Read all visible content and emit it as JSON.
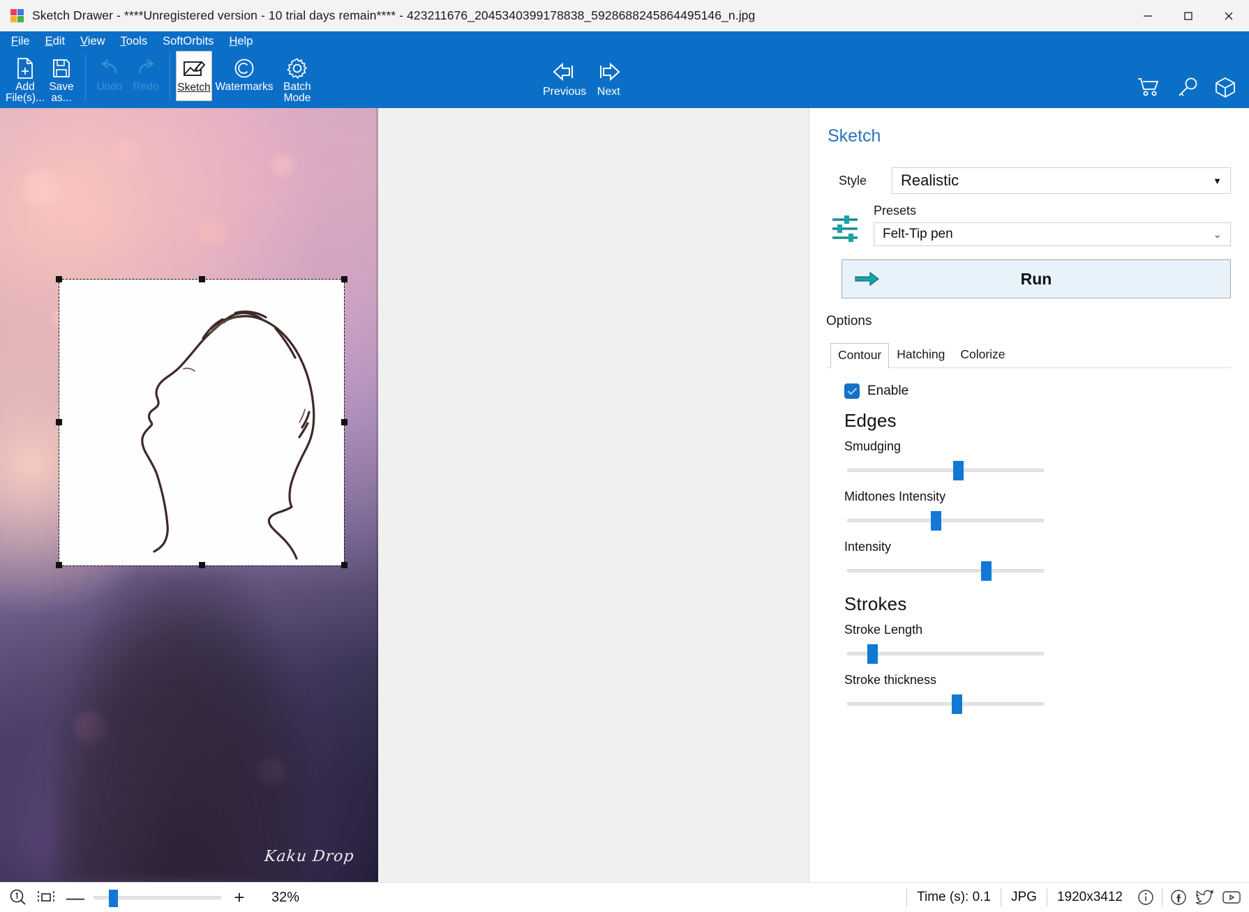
{
  "window": {
    "title": "Sketch Drawer - ****Unregistered version - 10 trial days remain**** - 423211676_2045340399178838_5928688245864495146_n.jpg",
    "minimize_label": "Minimize",
    "maximize_label": "Maximize",
    "close_label": "Close"
  },
  "menu": {
    "items": [
      {
        "label": "File",
        "accel": "F"
      },
      {
        "label": "Edit",
        "accel": "E"
      },
      {
        "label": "View",
        "accel": "V"
      },
      {
        "label": "Tools",
        "accel": "T"
      },
      {
        "label": "SoftOrbits",
        "accel": ""
      },
      {
        "label": "Help",
        "accel": "H"
      }
    ]
  },
  "toolbar": {
    "add_files": "Add\nFile(s)...",
    "add_files_line1": "Add",
    "add_files_line2": "File(s)...",
    "save_as_line1": "Save",
    "save_as_line2": "as...",
    "undo": "Undo",
    "redo": "Redo",
    "sketch": "Sketch",
    "watermarks": "Watermarks",
    "batch_line1": "Batch",
    "batch_line2": "Mode",
    "previous": "Previous",
    "next": "Next",
    "cart_icon": "cart-icon",
    "key_icon": "key-icon",
    "box_icon": "box-icon"
  },
  "panel": {
    "title": "Sketch",
    "style_label": "Style",
    "style_value": "Realistic",
    "presets_label": "Presets",
    "presets_value": "Felt-Tip pen",
    "run_label": "Run",
    "options_label": "Options",
    "tabs": [
      {
        "label": "Contour",
        "active": true
      },
      {
        "label": "Hatching",
        "active": false
      },
      {
        "label": "Colorize",
        "active": false
      }
    ],
    "enable_label": "Enable",
    "enable_checked": true,
    "groups": [
      {
        "heading": "Edges",
        "sliders": [
          {
            "label": "Smudging",
            "percent": 57
          },
          {
            "label": "Midtones Intensity",
            "percent": 45
          },
          {
            "label": "Intensity",
            "percent": 72
          }
        ]
      },
      {
        "heading": "Strokes",
        "sliders": [
          {
            "label": "Stroke Length",
            "percent": 11
          },
          {
            "label": "Stroke thickness",
            "percent": 56
          }
        ]
      }
    ]
  },
  "canvas": {
    "watermark": "Kaku Drop"
  },
  "statusbar": {
    "zoom_icon": "zoom-1to1-icon",
    "fit_icon": "fit-to-screen-icon",
    "zoom_out": "—",
    "zoom_in": "+",
    "zoom_percent": "32%",
    "zoom_slider_percent": 13,
    "time": "Time (s): 0.1",
    "format": "JPG",
    "dimensions": "1920x3412",
    "info_icon": "info-icon",
    "facebook_icon": "facebook-icon",
    "twitter_icon": "twitter-icon",
    "youtube_icon": "youtube-icon"
  },
  "colors": {
    "ribbon_blue": "#0c6fc7",
    "panel_title_blue": "#2a74c0",
    "accent_blue": "#1178d4",
    "run_bg": "#e8f2fb",
    "teal": "#18a3a8"
  }
}
